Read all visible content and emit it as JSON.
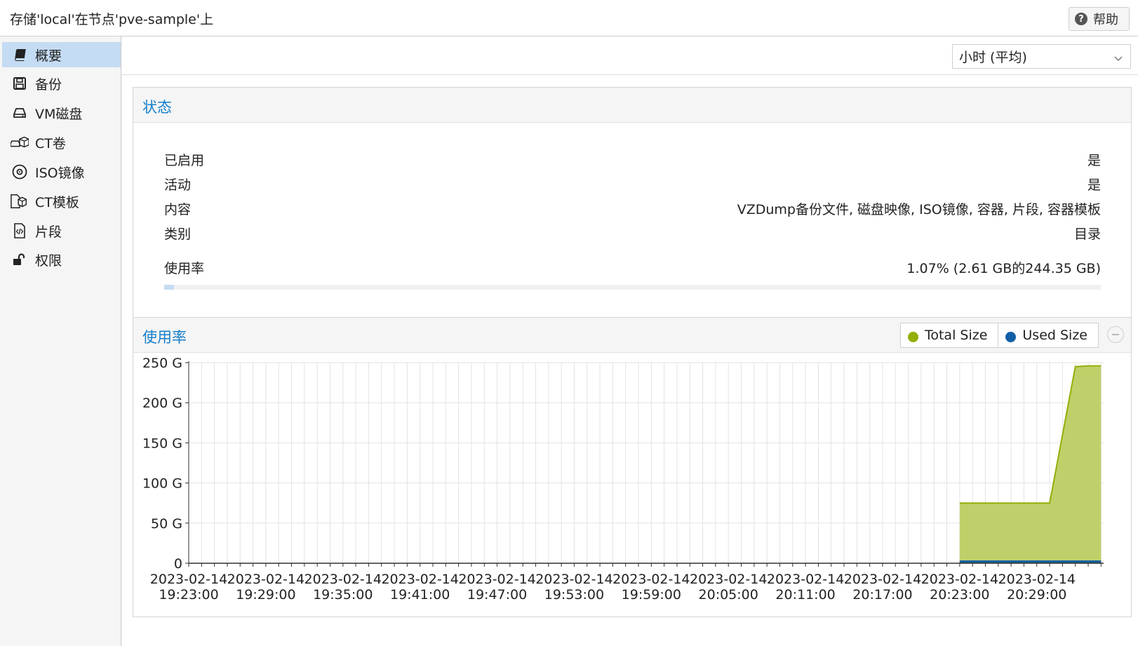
{
  "header": {
    "title": "存储'local'在节点'pve-sample'上",
    "help_label": "帮助"
  },
  "sidebar": {
    "items": [
      {
        "label": "概要",
        "icon": "book-icon",
        "active": true
      },
      {
        "label": "备份",
        "icon": "floppy-disk-icon"
      },
      {
        "label": "VM磁盘",
        "icon": "hard-drive-icon"
      },
      {
        "label": "CT卷",
        "icon": "container-volume-icon"
      },
      {
        "label": "ISO镜像",
        "icon": "disc-icon"
      },
      {
        "label": "CT模板",
        "icon": "container-template-icon"
      },
      {
        "label": "片段",
        "icon": "code-file-icon"
      },
      {
        "label": "权限",
        "icon": "unlock-icon"
      }
    ]
  },
  "toolbar": {
    "timeframe": "小时 (平均)"
  },
  "status": {
    "title": "状态",
    "rows": [
      {
        "label": "已启用",
        "value": "是"
      },
      {
        "label": "活动",
        "value": "是"
      },
      {
        "label": "内容",
        "value": "VZDump备份文件, 磁盘映像, ISO镜像, 容器, 片段, 容器模板"
      },
      {
        "label": "类别",
        "value": "目录"
      }
    ],
    "usage": {
      "label": "使用率",
      "value": "1.07% (2.61 GB的244.35 GB)",
      "fraction": 0.0107
    }
  },
  "usage_chart": {
    "title": "使用率",
    "legend": [
      {
        "name": "Total Size",
        "color": "#94ae0a"
      },
      {
        "name": "Used Size",
        "color": "#115fa6"
      }
    ]
  },
  "chart_data": {
    "type": "area",
    "title": "使用率",
    "ylim": [
      0,
      250
    ],
    "yticks": [
      0,
      50,
      100,
      150,
      200,
      250
    ],
    "ytick_labels": [
      "0",
      "50 G",
      "100 G",
      "150 G",
      "200 G",
      "250 G"
    ],
    "xlim": [
      "2023-02-14 19:23:00",
      "2023-02-14 20:33:00"
    ],
    "xtick_labels": [
      [
        "2023-02-14",
        "19:23:00"
      ],
      [
        "2023-02-14",
        "19:29:00"
      ],
      [
        "2023-02-14",
        "19:35:00"
      ],
      [
        "2023-02-14",
        "19:41:00"
      ],
      [
        "2023-02-14",
        "19:47:00"
      ],
      [
        "2023-02-14",
        "19:53:00"
      ],
      [
        "2023-02-14",
        "19:59:00"
      ],
      [
        "2023-02-14",
        "20:05:00"
      ],
      [
        "2023-02-14",
        "20:11:00"
      ],
      [
        "2023-02-14",
        "20:17:00"
      ],
      [
        "2023-02-14",
        "20:23:00"
      ],
      [
        "2023-02-14",
        "20:29:00"
      ]
    ],
    "grid": true,
    "legend_position": "top-right",
    "series": [
      {
        "name": "Total Size",
        "color": "#94ae0a",
        "fill": "#bfd06a",
        "points": [
          [
            "2023-02-14 20:23:00",
            75
          ],
          [
            "2023-02-14 20:30:00",
            75
          ],
          [
            "2023-02-14 20:32:00",
            245
          ],
          [
            "2023-02-14 20:33:00",
            246
          ],
          [
            "2023-02-14 20:34:00",
            246
          ]
        ]
      },
      {
        "name": "Used Size",
        "color": "#115fa6",
        "fill": "#1f5f8f",
        "points": [
          [
            "2023-02-14 20:23:00",
            2.6
          ],
          [
            "2023-02-14 20:30:00",
            2.6
          ],
          [
            "2023-02-14 20:32:00",
            2.6
          ],
          [
            "2023-02-14 20:33:00",
            2.6
          ],
          [
            "2023-02-14 20:34:00",
            2.6
          ]
        ]
      }
    ]
  }
}
